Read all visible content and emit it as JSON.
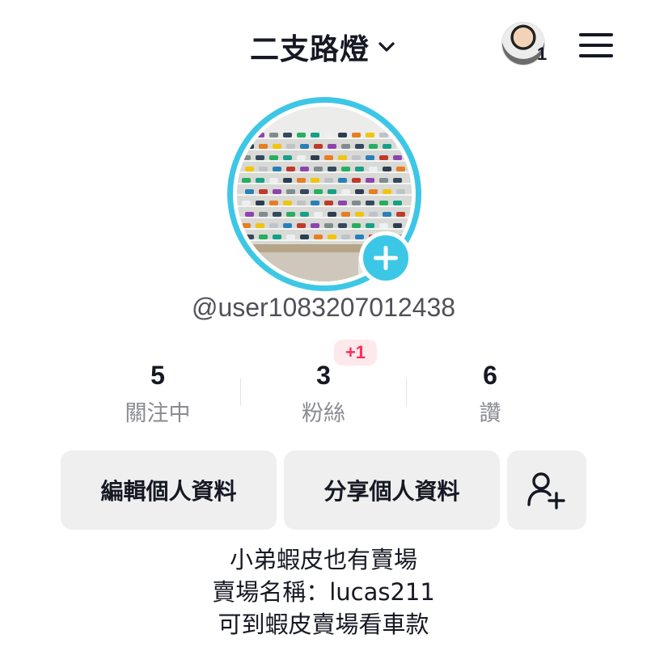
{
  "header": {
    "title": "二支路燈",
    "notification_count": "1"
  },
  "profile": {
    "username": "@user1083207012438",
    "new_followers_badge": "+1",
    "ring_color": "#3dc7e6"
  },
  "stats": [
    {
      "value": "5",
      "label": "關注中"
    },
    {
      "value": "3",
      "label": "粉絲"
    },
    {
      "value": "6",
      "label": "讚"
    }
  ],
  "buttons": {
    "edit": "編輯個人資料",
    "share": "分享個人資料"
  },
  "bio": {
    "lines": [
      "小弟蝦皮也有賣場",
      "賣場名稱：lucas211",
      "可到蝦皮賣場看車款"
    ]
  },
  "icons": {
    "chevron": "chevron-down-icon",
    "menu": "hamburger-menu-icon",
    "add_friend": "add-user-icon",
    "plus": "plus-icon"
  }
}
